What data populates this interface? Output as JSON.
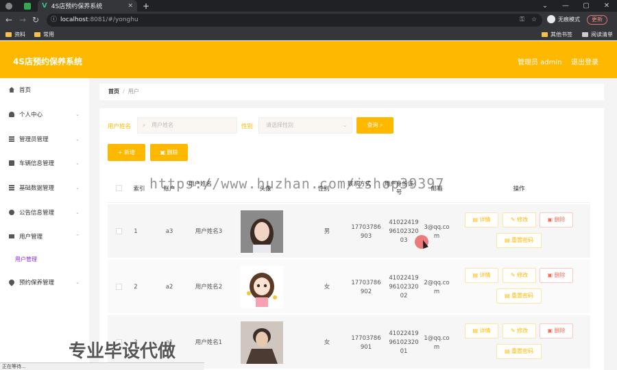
{
  "browser": {
    "tab_title": "4S店预约保养系统",
    "url_host": "localhost",
    "url_path": ":8081/#/yonghu",
    "incognito_label": "无痕模式",
    "update_label": "更新",
    "bookmarks": [
      "资料",
      "常用"
    ],
    "bookmarks_right": [
      "其他书签",
      "阅读清单"
    ]
  },
  "header": {
    "title": "4S店预约保养系统",
    "admin_label": "管理员 admin",
    "logout_label": "退出登录"
  },
  "sidebar": {
    "items": [
      {
        "label": "首页",
        "icon": "home-icon"
      },
      {
        "label": "个人中心",
        "icon": "user-icon"
      },
      {
        "label": "管理员管理",
        "icon": "list-icon"
      },
      {
        "label": "车辆信息管理",
        "icon": "car-icon"
      },
      {
        "label": "基础数据管理",
        "icon": "list-icon"
      },
      {
        "label": "公告信息管理",
        "icon": "notice-icon"
      },
      {
        "label": "用户管理",
        "icon": "monitor-icon"
      },
      {
        "label": "预约保养管理",
        "icon": "pin-icon"
      }
    ],
    "active_sub": "用户管理"
  },
  "breadcrumb": {
    "home": "首页",
    "current": "用户"
  },
  "search": {
    "name_label": "用户姓名",
    "name_placeholder": "用户姓名",
    "gender_label": "性别",
    "gender_placeholder": "请选择性别",
    "query_button": "查询"
  },
  "actions": {
    "add": "新增",
    "delete": "删除"
  },
  "table": {
    "headers": {
      "index": "索引",
      "account": "账户",
      "name": "用户姓名",
      "avatar": "头像",
      "gender": "性别",
      "phone": "联系方式",
      "idcard": "用户身份证号",
      "email": "邮箱",
      "ops": "操作"
    },
    "rows": [
      {
        "index": "1",
        "account": "a3",
        "name": "用户姓名3",
        "gender": "男",
        "phone": [
          "17703786",
          "903"
        ],
        "idcard": [
          "41022419",
          "96102320",
          "03"
        ],
        "email": [
          "3@qq.co",
          "m"
        ]
      },
      {
        "index": "2",
        "account": "a2",
        "name": "用户姓名2",
        "gender": "女",
        "phone": [
          "17703786",
          "902"
        ],
        "idcard": [
          "41022419",
          "96102320",
          "02"
        ],
        "email": [
          "2@qq.co",
          "m"
        ]
      },
      {
        "index": "3",
        "account": "a1",
        "name": "用户姓名1",
        "gender": "女",
        "phone": [
          "17703786",
          "901"
        ],
        "idcard": [
          "41022419",
          "96102320",
          "01"
        ],
        "email": [
          "1@qq.co",
          "m"
        ]
      }
    ],
    "op_labels": {
      "detail": "详情",
      "edit": "修改",
      "remove": "删除",
      "reset": "重置密码"
    }
  },
  "overlay": {
    "watermark": "https://www.huzhan.com/ishop39397",
    "promo": "专业毕设代做",
    "status": "正在等待..."
  }
}
